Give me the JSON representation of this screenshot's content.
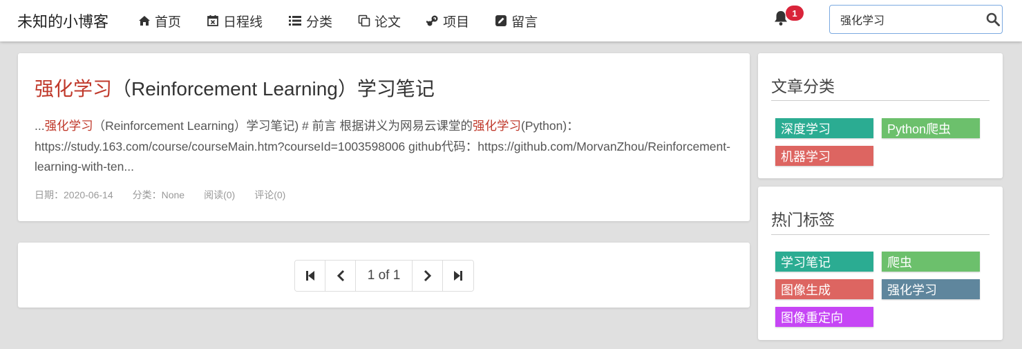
{
  "brand": "未知的小博客",
  "nav": [
    {
      "label": "首页",
      "icon": "home-icon"
    },
    {
      "label": "日程线",
      "icon": "calendar-icon"
    },
    {
      "label": "分类",
      "icon": "list-icon"
    },
    {
      "label": "论文",
      "icon": "copy-icon"
    },
    {
      "label": "项目",
      "icon": "steam-icon"
    },
    {
      "label": "留言",
      "icon": "edit-icon"
    }
  ],
  "notifications": {
    "count": "1"
  },
  "search": {
    "value": "强化学习"
  },
  "article": {
    "title_hl": "强化学习",
    "title_rest": "（Reinforcement Learning）学习笔记",
    "excerpt_prefix": "...",
    "excerpt_hl1": "强化学习",
    "excerpt_mid": "（Reinforcement Learning）学习笔记) # 前言 根据讲义为网易云课堂的",
    "excerpt_hl2": "强化学习",
    "excerpt_rest": "(Python)：https://study.163.com/course/courseMain.htm?courseId=1003598006 github代码：https://github.com/MorvanZhou/Reinforcement-learning-with-ten...",
    "meta": {
      "date": "日期：2020-06-14",
      "category": "分类：None",
      "reads": "阅读(0)",
      "comments": "评论(0)"
    }
  },
  "pager": {
    "info": "1 of 1"
  },
  "categories": {
    "title": "文章分类",
    "items": [
      {
        "label": "深度学习",
        "color": "#2bac92"
      },
      {
        "label": "Python爬虫",
        "color": "#6cc06c"
      },
      {
        "label": "机器学习",
        "color": "#dd6561"
      }
    ]
  },
  "hot_tags": {
    "title": "热门标签",
    "items": [
      {
        "label": "学习笔记",
        "color": "#2bac92"
      },
      {
        "label": "爬虫",
        "color": "#6cc06c"
      },
      {
        "label": "图像生成",
        "color": "#dd6561"
      },
      {
        "label": "强化学习",
        "color": "#5f869d"
      },
      {
        "label": "图像重定向",
        "color": "#c646f5"
      }
    ]
  }
}
